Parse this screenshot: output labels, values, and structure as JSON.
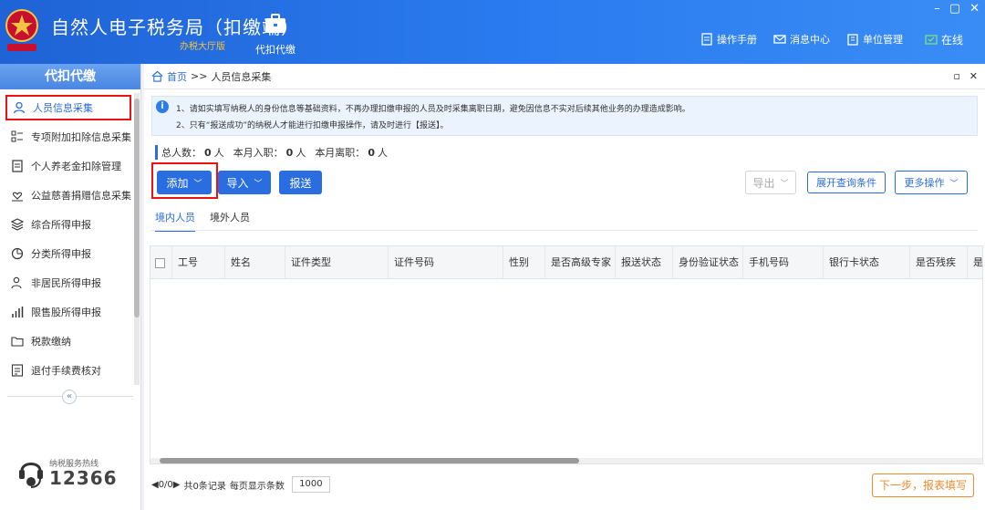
{
  "window": {
    "title": "自然人电子税务局（扣缴端）",
    "subtitle": "办税大厅版",
    "controls": [
      "–",
      "▢",
      "✕"
    ]
  },
  "topnav": {
    "center_item": "代扣代缴",
    "right_items": [
      {
        "label": "操作手册",
        "icon": "manual-icon"
      },
      {
        "label": "消息中心",
        "icon": "mail-icon"
      },
      {
        "label": "单位管理",
        "icon": "building-icon"
      },
      {
        "label": "在线",
        "icon": "online-status-icon"
      }
    ]
  },
  "sidebar": {
    "title": "代扣代缴",
    "items": [
      {
        "label": "人员信息采集",
        "icon": "person-icon",
        "active": true
      },
      {
        "label": "专项附加扣除信息采集",
        "icon": "grid-list-icon",
        "active": false
      },
      {
        "label": "个人养老金扣除管理",
        "icon": "document-icon",
        "active": false
      },
      {
        "label": "公益慈善捐赠信息采集",
        "icon": "donation-icon",
        "active": false
      },
      {
        "label": "综合所得申报",
        "icon": "layers-icon",
        "active": false
      },
      {
        "label": "分类所得申报",
        "icon": "pie-icon",
        "active": false
      },
      {
        "label": "非居民所得申报",
        "icon": "person-outline-icon",
        "active": false
      },
      {
        "label": "限售股所得申报",
        "icon": "bar-chart-icon",
        "active": false
      },
      {
        "label": "税款缴纳",
        "icon": "folder-icon",
        "active": false
      },
      {
        "label": "退付手续费核对",
        "icon": "checklist-icon",
        "active": false
      }
    ],
    "collapse_glyph": "«",
    "hotline": {
      "label": "纳税服务热线",
      "number": "12366"
    }
  },
  "breadcrumb": {
    "home": "首页",
    "separator": ">>",
    "current": "人员信息采集",
    "controls": [
      "▫",
      "✕"
    ]
  },
  "notice": {
    "icon_glyph": "i",
    "lines": [
      "1、请如实填写纳税人的身份信息等基础资料，不再办理扣缴申报的人员及时采集离职日期，避免因信息不实对后续其他业务的办理造成影响。",
      "2、只有“报送成功”的纳税人才能进行扣缴申报操作，请及时进行【报送】。"
    ]
  },
  "stats": {
    "total_label": "总人数：",
    "total_value": "0",
    "joined_label": "本月入职：",
    "joined_value": "0",
    "left_label": "本月离职：",
    "left_value": "0",
    "unit": "人"
  },
  "toolbar": {
    "add": "添加",
    "import": "导入",
    "submit": "报送",
    "export": "导出",
    "expand_query": "展开查询条件",
    "more": "更多操作",
    "chevron": "﹀"
  },
  "tabs": [
    "境内人员",
    "境外人员"
  ],
  "table": {
    "columns": [
      "工号",
      "姓名",
      "证件类型",
      "证件号码",
      "性别",
      "是否高级专家",
      "报送状态",
      "身份验证状态",
      "手机号码",
      "银行卡状态",
      "是否残疾",
      "是"
    ],
    "rows": []
  },
  "pager": {
    "nav": "◀0/0▶",
    "records": "共0条记录",
    "page_size_label": "每页显示条数",
    "page_size": "1000"
  },
  "next_button": "下一步，报表填写",
  "colors": {
    "primary": "#2a6de0",
    "highlight": "#e11111",
    "next": "#f08a2c"
  }
}
